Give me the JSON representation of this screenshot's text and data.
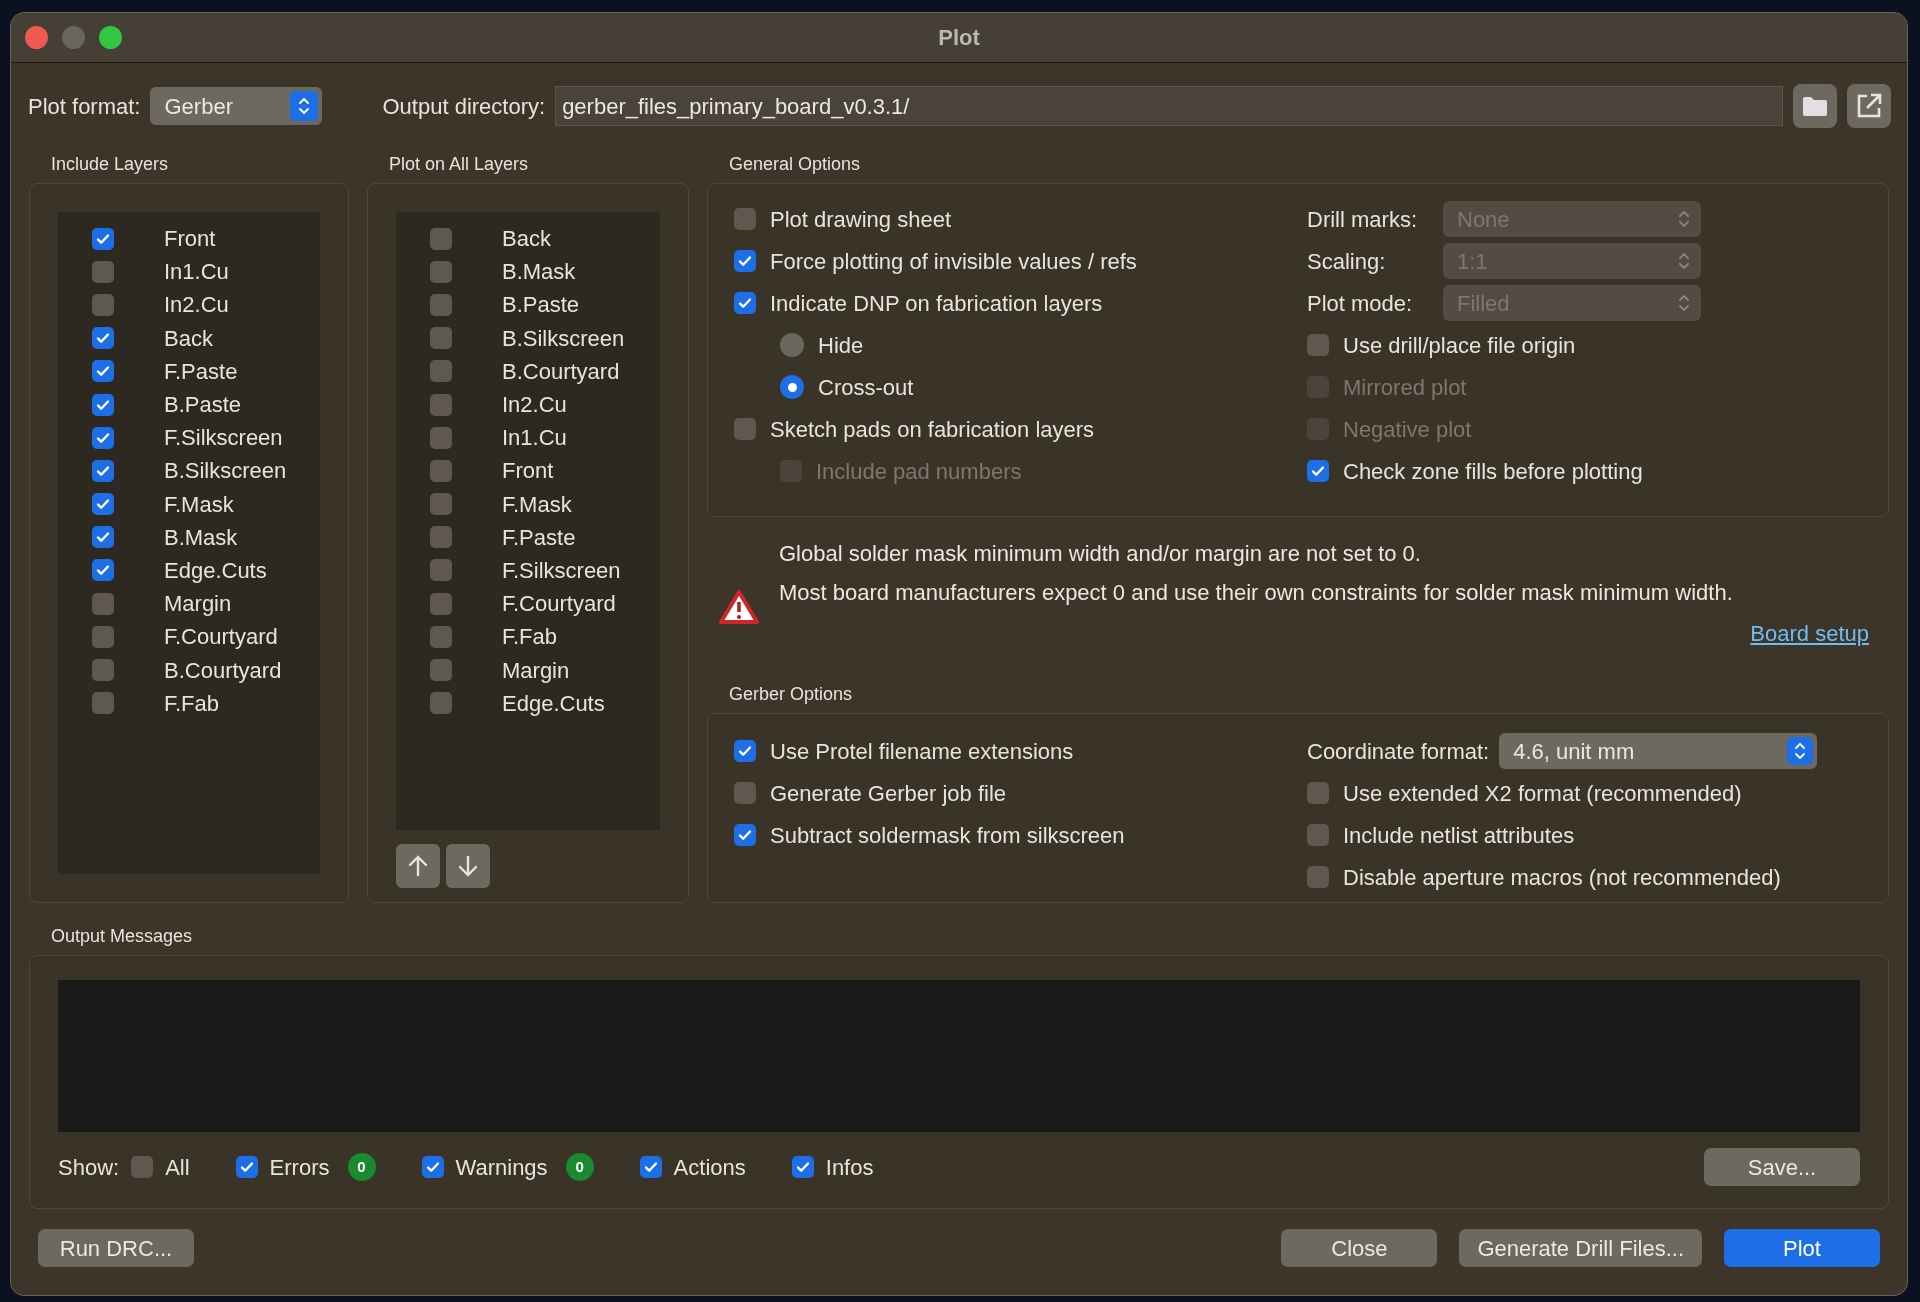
{
  "window": {
    "title": "Plot"
  },
  "plot_format": {
    "label": "Plot format:",
    "value": "Gerber"
  },
  "output_directory": {
    "label": "Output directory:",
    "value": "gerber_files_primary_board_v0.3.1/"
  },
  "include_layers": {
    "title": "Include Layers",
    "items": [
      {
        "label": "Front",
        "checked": true
      },
      {
        "label": "In1.Cu",
        "checked": false
      },
      {
        "label": "In2.Cu",
        "checked": false
      },
      {
        "label": "Back",
        "checked": true
      },
      {
        "label": "F.Paste",
        "checked": true
      },
      {
        "label": "B.Paste",
        "checked": true
      },
      {
        "label": "F.Silkscreen",
        "checked": true
      },
      {
        "label": "B.Silkscreen",
        "checked": true
      },
      {
        "label": "F.Mask",
        "checked": true
      },
      {
        "label": "B.Mask",
        "checked": true
      },
      {
        "label": "Edge.Cuts",
        "checked": true
      },
      {
        "label": "Margin",
        "checked": false
      },
      {
        "label": "F.Courtyard",
        "checked": false
      },
      {
        "label": "B.Courtyard",
        "checked": false
      },
      {
        "label": "F.Fab",
        "checked": false
      }
    ]
  },
  "plot_on_all_layers": {
    "title": "Plot on All Layers",
    "items": [
      {
        "label": "Back",
        "checked": false
      },
      {
        "label": "B.Mask",
        "checked": false
      },
      {
        "label": "B.Paste",
        "checked": false
      },
      {
        "label": "B.Silkscreen",
        "checked": false
      },
      {
        "label": "B.Courtyard",
        "checked": false
      },
      {
        "label": "In2.Cu",
        "checked": false
      },
      {
        "label": "In1.Cu",
        "checked": false
      },
      {
        "label": "Front",
        "checked": false
      },
      {
        "label": "F.Mask",
        "checked": false
      },
      {
        "label": "F.Paste",
        "checked": false
      },
      {
        "label": "F.Silkscreen",
        "checked": false
      },
      {
        "label": "F.Courtyard",
        "checked": false
      },
      {
        "label": "F.Fab",
        "checked": false
      },
      {
        "label": "Margin",
        "checked": false
      },
      {
        "label": "Edge.Cuts",
        "checked": false
      }
    ]
  },
  "general_options": {
    "title": "General Options",
    "left": [
      {
        "kind": "checkbox",
        "label": "Plot drawing sheet",
        "checked": false,
        "disabled": false
      },
      {
        "kind": "checkbox",
        "label": "Force plotting of invisible values / refs",
        "checked": true,
        "disabled": false
      },
      {
        "kind": "checkbox",
        "label": "Indicate DNP on fabrication layers",
        "checked": true,
        "disabled": false,
        "children": [
          {
            "kind": "radio",
            "label": "Hide",
            "selected": false
          },
          {
            "kind": "radio",
            "label": "Cross-out",
            "selected": true
          }
        ]
      },
      {
        "kind": "checkbox",
        "label": "Sketch pads on fabrication layers",
        "checked": false,
        "disabled": false,
        "children": [
          {
            "kind": "checkbox",
            "label": "Include pad numbers",
            "checked": false,
            "disabled": true
          }
        ]
      }
    ],
    "selects": [
      {
        "label": "Drill marks:",
        "value": "None",
        "disabled": true
      },
      {
        "label": "Scaling:",
        "value": "1:1",
        "disabled": true
      },
      {
        "label": "Plot mode:",
        "value": "Filled",
        "disabled": true
      }
    ],
    "right": [
      {
        "kind": "checkbox",
        "label": "Use drill/place file origin",
        "checked": false,
        "disabled": false
      },
      {
        "kind": "checkbox",
        "label": "Mirrored plot",
        "checked": false,
        "disabled": true
      },
      {
        "kind": "checkbox",
        "label": "Negative plot",
        "checked": false,
        "disabled": true
      },
      {
        "kind": "checkbox",
        "label": "Check zone fills before plotting",
        "checked": true,
        "disabled": false
      }
    ]
  },
  "warning": {
    "lines": [
      "Global solder mask minimum width and/or margin are not set to 0.",
      "Most board manufacturers expect 0 and use their own constraints for solder mask minimum width."
    ],
    "link": "Board setup"
  },
  "gerber_options": {
    "title": "Gerber Options",
    "left": [
      {
        "kind": "checkbox",
        "label": "Use Protel filename extensions",
        "checked": true,
        "disabled": false
      },
      {
        "kind": "checkbox",
        "label": "Generate Gerber job file",
        "checked": false,
        "disabled": false
      },
      {
        "kind": "checkbox",
        "label": "Subtract soldermask from silkscreen",
        "checked": true,
        "disabled": false
      }
    ],
    "coordinate_format": {
      "label": "Coordinate format:",
      "value": "4.6, unit mm",
      "disabled": false
    },
    "right": [
      {
        "kind": "checkbox",
        "label": "Use extended X2 format (recommended)",
        "checked": false,
        "disabled": false
      },
      {
        "kind": "checkbox",
        "label": "Include netlist attributes",
        "checked": false,
        "disabled": false
      },
      {
        "kind": "checkbox",
        "label": "Disable aperture macros (not recommended)",
        "checked": false,
        "disabled": false
      }
    ]
  },
  "output_messages": {
    "title": "Output Messages",
    "show_label": "Show:",
    "filters": [
      {
        "label": "All",
        "checked": false
      },
      {
        "label": "Errors",
        "checked": true,
        "count": "0"
      },
      {
        "label": "Warnings",
        "checked": true,
        "count": "0"
      },
      {
        "label": "Actions",
        "checked": true
      },
      {
        "label": "Infos",
        "checked": true
      }
    ],
    "save": "Save..."
  },
  "buttons": {
    "left": "Run DRC...",
    "right": [
      {
        "label": "Close",
        "kind": "secondary"
      },
      {
        "label": "Generate Drill Files...",
        "kind": "secondary"
      },
      {
        "label": "Plot",
        "kind": "primary"
      }
    ]
  }
}
